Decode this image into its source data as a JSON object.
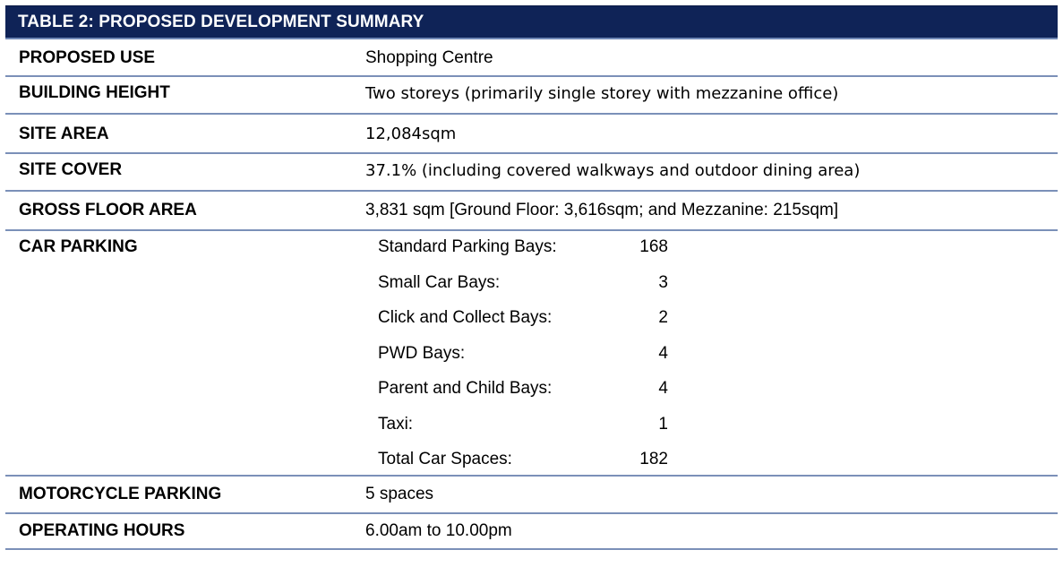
{
  "title": "TABLE 2:  PROPOSED DEVELOPMENT SUMMARY",
  "rows": {
    "proposed_use": {
      "label": "PROPOSED USE",
      "value": "Shopping Centre"
    },
    "building_height": {
      "label": "BUILDING HEIGHT",
      "value": "Two storeys (primarily single storey with mezzanine office)"
    },
    "site_area": {
      "label": "SITE AREA",
      "value": "12,084sqm"
    },
    "site_cover": {
      "label": "SITE COVER",
      "value": "37.1% (including covered walkways and outdoor dining area)"
    },
    "gross_floor_area": {
      "label": "GROSS FLOOR AREA",
      "value": "3,831 sqm [Ground Floor: 3,616sqm; and Mezzanine: 215sqm]"
    },
    "car_parking": {
      "label": "CAR PARKING",
      "items": [
        {
          "label": "Standard Parking Bays:",
          "count": "168"
        },
        {
          "label": "Small Car Bays:",
          "count": "3"
        },
        {
          "label": "Click and Collect Bays:",
          "count": "2"
        },
        {
          "label": "PWD Bays:",
          "count": "4"
        },
        {
          "label": "Parent and Child Bays:",
          "count": "4"
        },
        {
          "label": "Taxi:",
          "count": "1"
        },
        {
          "label": "Total Car Spaces:",
          "count": "182"
        }
      ]
    },
    "motorcycle_parking": {
      "label": "MOTORCYCLE PARKING",
      "value": "5 spaces"
    },
    "operating_hours": {
      "label": "OPERATING HOURS",
      "value": "6.00am to 10.00pm"
    }
  },
  "colors": {
    "header_bg": "#0f2357",
    "header_text": "#ffffff",
    "row_divider": "#7b90b8"
  }
}
